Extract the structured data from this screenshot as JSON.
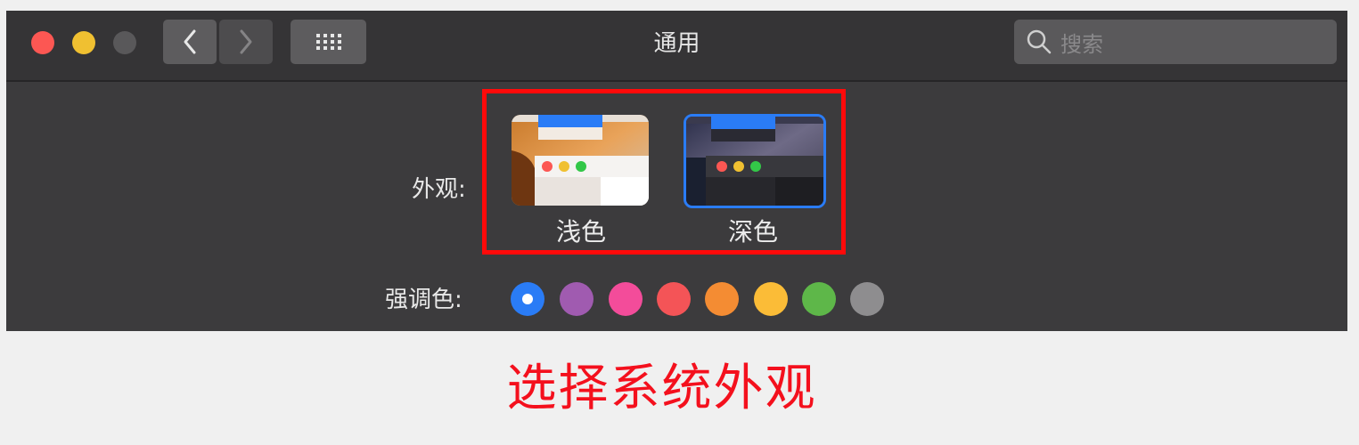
{
  "window": {
    "title": "通用",
    "search_placeholder": "搜索"
  },
  "appearance": {
    "label": "外观:",
    "options": [
      {
        "label": "浅色",
        "selected": false
      },
      {
        "label": "深色",
        "selected": true
      }
    ]
  },
  "accent": {
    "label": "强调色:",
    "selected_index": 0,
    "colors": [
      "#2a7cf6",
      "#a05bb0",
      "#f34c9a",
      "#f45457",
      "#f48c33",
      "#fbbc37",
      "#5eb749",
      "#8e8d8f"
    ]
  },
  "caption": "选择系统外观",
  "colors": {
    "highlight": "#ff0a0a",
    "traffic_close": "#fc5753",
    "traffic_minimize": "#f0c031",
    "traffic_zoom_disabled": "#59585a"
  },
  "icons": [
    "close-traffic-light",
    "minimize-traffic-light",
    "zoom-traffic-light",
    "chevron-left-icon",
    "chevron-right-icon",
    "grid-icon",
    "search-icon"
  ]
}
